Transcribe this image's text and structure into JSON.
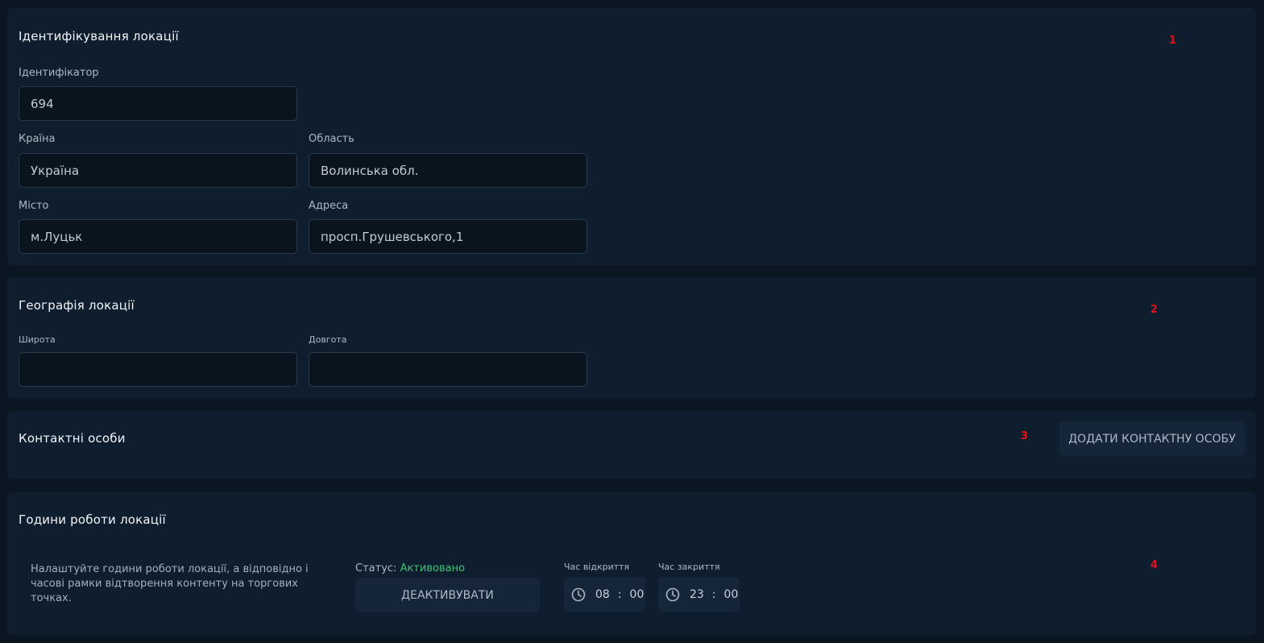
{
  "identification": {
    "title": "Ідентифікування локації",
    "marker": "1",
    "id_label": "Ідентифікатор",
    "id_value": "694",
    "country_label": "Країна",
    "country_value": "Україна",
    "region_label": "Область",
    "region_value": "Волинська обл.",
    "city_label": "Місто",
    "city_value": "м.Луцьк",
    "address_label": "Адреса",
    "address_value": "просп.Грушевського,1"
  },
  "geography": {
    "title": "Географія локації",
    "marker": "2",
    "lat_label": "Широта",
    "lat_value": "",
    "lon_label": "Довгота",
    "lon_value": ""
  },
  "contacts": {
    "title": "Контактні особи",
    "marker": "3",
    "add_button": "ДОДАТИ КОНТАКТНУ ОСОБУ"
  },
  "hours": {
    "title": "Години роботи локації",
    "marker": "4",
    "description": "Налаштуйте години роботи локації, а відповідно і часові рамки відтворення контенту на торгових точках.",
    "status_label": "Статус:",
    "status_value": "Активовано",
    "deactivate_button": "ДЕАКТИВУВАТИ",
    "open_label": "Час відкриття",
    "open_hh": "08",
    "open_mm": "00",
    "close_label": "Час закриття",
    "close_hh": "23",
    "close_mm": "00",
    "separator": ":"
  },
  "colors": {
    "background": "#0a1622",
    "panel": "#0f1e2f",
    "input": "#0a141f",
    "button": "#15263a",
    "status_active": "#3fc277",
    "marker": "#e0121b"
  },
  "icons": [
    "clock-icon"
  ]
}
